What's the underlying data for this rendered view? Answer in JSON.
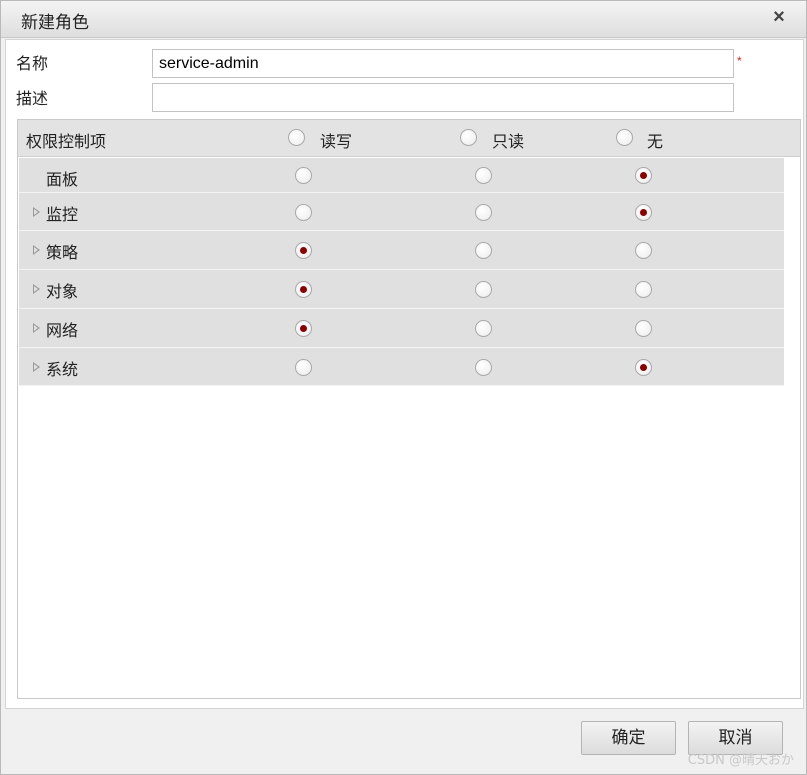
{
  "dialog": {
    "title": "新建角色",
    "close_glyph": "×"
  },
  "form": {
    "name_label": "名称",
    "name_value": "service-admin",
    "required_mark": "*",
    "desc_label": "描述",
    "desc_value": ""
  },
  "permissions": {
    "header": {
      "label": "权限控制项",
      "options": [
        "读写",
        "只读",
        "无"
      ],
      "selected": null
    },
    "rows": [
      {
        "label": "面板",
        "expandable": false,
        "selected": "无"
      },
      {
        "label": "监控",
        "expandable": true,
        "selected": "无"
      },
      {
        "label": "策略",
        "expandable": true,
        "selected": "读写"
      },
      {
        "label": "对象",
        "expandable": true,
        "selected": "读写"
      },
      {
        "label": "网络",
        "expandable": true,
        "selected": "读写"
      },
      {
        "label": "系统",
        "expandable": true,
        "selected": "无"
      }
    ]
  },
  "footer": {
    "confirm_label": "确定",
    "cancel_label": "取消",
    "watermark": "CSDN @晴天おか"
  },
  "colors": {
    "radio_checked": "#8b0000",
    "row_background": "#e0e0e0",
    "header_background": "#e3e3e3",
    "required": "#e02020"
  }
}
